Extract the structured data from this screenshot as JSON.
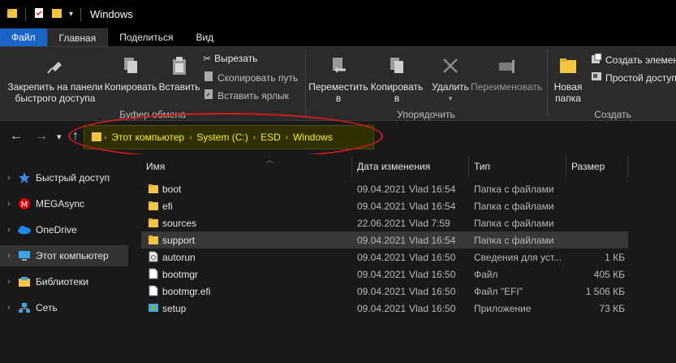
{
  "window": {
    "title": "Windows"
  },
  "tabs": [
    {
      "label": "Файл"
    },
    {
      "label": "Главная"
    },
    {
      "label": "Поделиться"
    },
    {
      "label": "Вид"
    }
  ],
  "ribbon": {
    "clipboard": {
      "pin_line1": "Закрепить на панели",
      "pin_line2": "быстрого доступа",
      "copy": "Копировать",
      "paste": "Вставить",
      "cut": "Вырезать",
      "copy_path": "Скопировать путь",
      "paste_shortcut": "Вставить ярлык",
      "group": "Буфер обмена"
    },
    "organize": {
      "move_line1": "Переместить",
      "move_line2": "в",
      "copyto_line1": "Копировать",
      "copyto_line2": "в",
      "delete": "Удалить",
      "rename": "Переименовать",
      "group": "Упорядочить"
    },
    "create": {
      "new_folder_line1": "Новая",
      "new_folder_line2": "папка",
      "new_item": "Создать элемент",
      "easy_access": "Простой доступ",
      "group": "Создать"
    }
  },
  "address": {
    "crumbs": [
      "Этот компьютер",
      "System (C:)",
      "ESD",
      "Windows"
    ]
  },
  "nav": [
    {
      "label": "Быстрый доступ",
      "icon": "star-icon"
    },
    {
      "label": "MEGAsync",
      "icon": "mega-icon"
    },
    {
      "label": "OneDrive",
      "icon": "cloud-icon"
    },
    {
      "label": "Этот компьютер",
      "icon": "computer-icon"
    },
    {
      "label": "Библиотеки",
      "icon": "library-icon"
    },
    {
      "label": "Сеть",
      "icon": "network-icon"
    }
  ],
  "columns": {
    "name": "Имя",
    "date": "Дата изменения",
    "type": "Тип",
    "size": "Размер"
  },
  "files": [
    {
      "name": "boot",
      "date": "09.04.2021",
      "time": "Vlad 16:54",
      "type": "Папка с файлами",
      "size": "",
      "icon": "folder-icon"
    },
    {
      "name": "efi",
      "date": "09.04.2021",
      "time": "Vlad 16:54",
      "type": "Папка с файлами",
      "size": "",
      "icon": "folder-icon"
    },
    {
      "name": "sources",
      "date": "22.06.2021",
      "time": "Vlad 7:59",
      "type": "Папка с файлами",
      "size": "",
      "icon": "folder-icon"
    },
    {
      "name": "support",
      "date": "09.04.2021",
      "time": "Vlad 16:54",
      "type": "Папка с файлами",
      "size": "",
      "icon": "folder-icon"
    },
    {
      "name": "autorun",
      "date": "09.04.2021",
      "time": "Vlad 16:50",
      "type": "Сведения для уст...",
      "size": "1 КБ",
      "icon": "settings-file-icon"
    },
    {
      "name": "bootmgr",
      "date": "09.04.2021",
      "time": "Vlad 16:50",
      "type": "Файл",
      "size": "405 КБ",
      "icon": "file-icon"
    },
    {
      "name": "bootmgr.efi",
      "date": "09.04.2021",
      "time": "Vlad 16:50",
      "type": "Файл \"EFI\"",
      "size": "1 506 КБ",
      "icon": "file-icon"
    },
    {
      "name": "setup",
      "date": "09.04.2021",
      "time": "Vlad 16:50",
      "type": "Приложение",
      "size": "73 КБ",
      "icon": "setup-icon"
    }
  ],
  "colors": {
    "accent": "#1a64c8",
    "address_text": "#ffee22",
    "highlight_loop": "#d41c1c"
  }
}
